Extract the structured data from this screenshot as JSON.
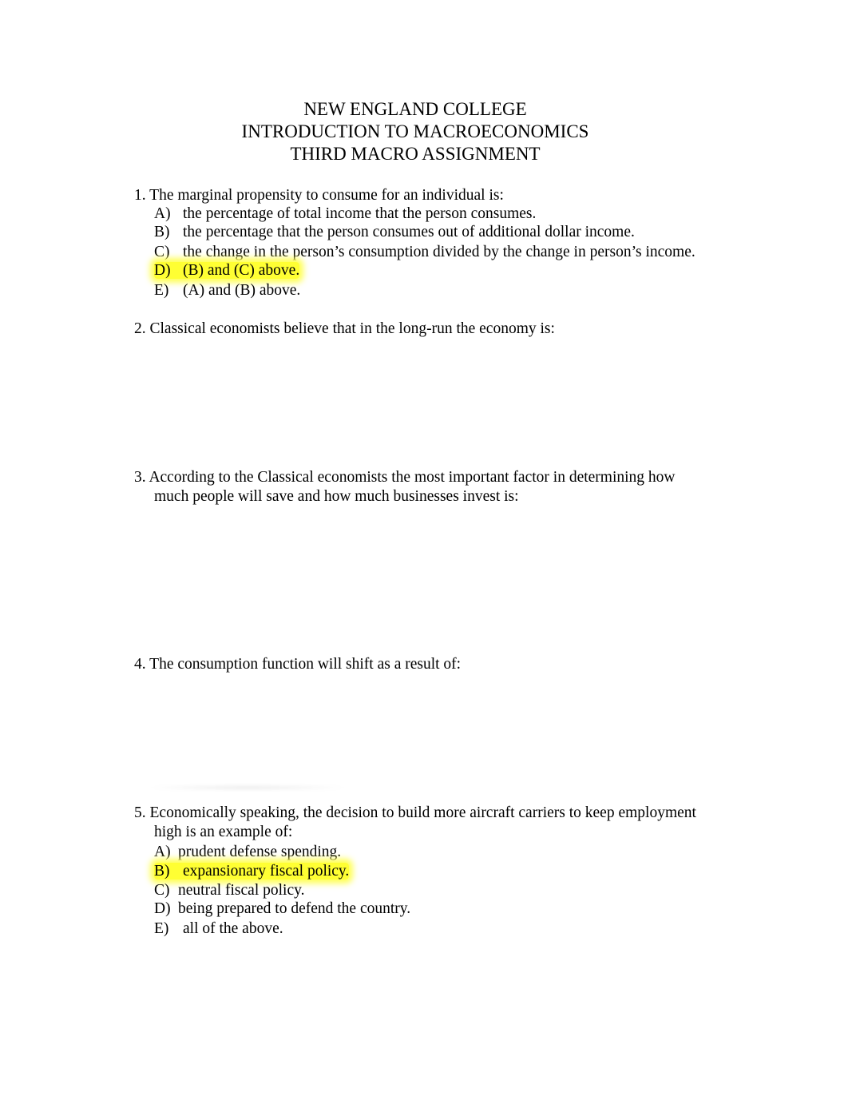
{
  "header": {
    "line1": "NEW ENGLAND COLLEGE",
    "line2": "INTRODUCTION TO MACROECONOMICS",
    "line3": "THIRD MACRO ASSIGNMENT"
  },
  "questions": [
    {
      "number": "1.",
      "text": "The marginal propensity to consume for an individual is:",
      "options": [
        {
          "letter": "A)",
          "text": "the percentage of total income that the person consumes.",
          "highlighted": false
        },
        {
          "letter": "B)",
          "text": "the percentage that the person consumes out of additional dollar income.",
          "highlighted": false
        },
        {
          "letter": "C)",
          "text": "the change in the person’s consumption divided by the change in person’s income.",
          "highlighted": false
        },
        {
          "letter": "D)",
          "text": "(B) and (C) above.",
          "highlighted": true
        },
        {
          "letter": "E)",
          "text": "(A) and (B) above.",
          "highlighted": false
        }
      ]
    },
    {
      "number": "2.",
      "text": "Classical economists believe that in the long-run the economy is:"
    },
    {
      "number": "3.",
      "text": "According to the Classical economists the most important factor in determining how",
      "continuation": "much people will save and how much businesses invest is:"
    },
    {
      "number": "4.",
      "text": "The consumption function will shift as a result of:"
    },
    {
      "number": "5.",
      "text": "Economically speaking, the decision to build more aircraft carriers to keep employment",
      "continuation": "high is an example of:",
      "options": [
        {
          "letter": "A)",
          "text": "prudent defense spending.",
          "highlighted": false
        },
        {
          "letter": "B)",
          "text": "expansionary fiscal policy.",
          "highlighted": true
        },
        {
          "letter": "C)",
          "text": "neutral fiscal policy.",
          "highlighted": false
        },
        {
          "letter": "D)",
          "text": "being prepared to defend the country.",
          "highlighted": false
        },
        {
          "letter": "E)",
          "text": "all of the above.",
          "highlighted": false
        }
      ]
    }
  ],
  "colors": {
    "highlight": "#ffff33"
  }
}
